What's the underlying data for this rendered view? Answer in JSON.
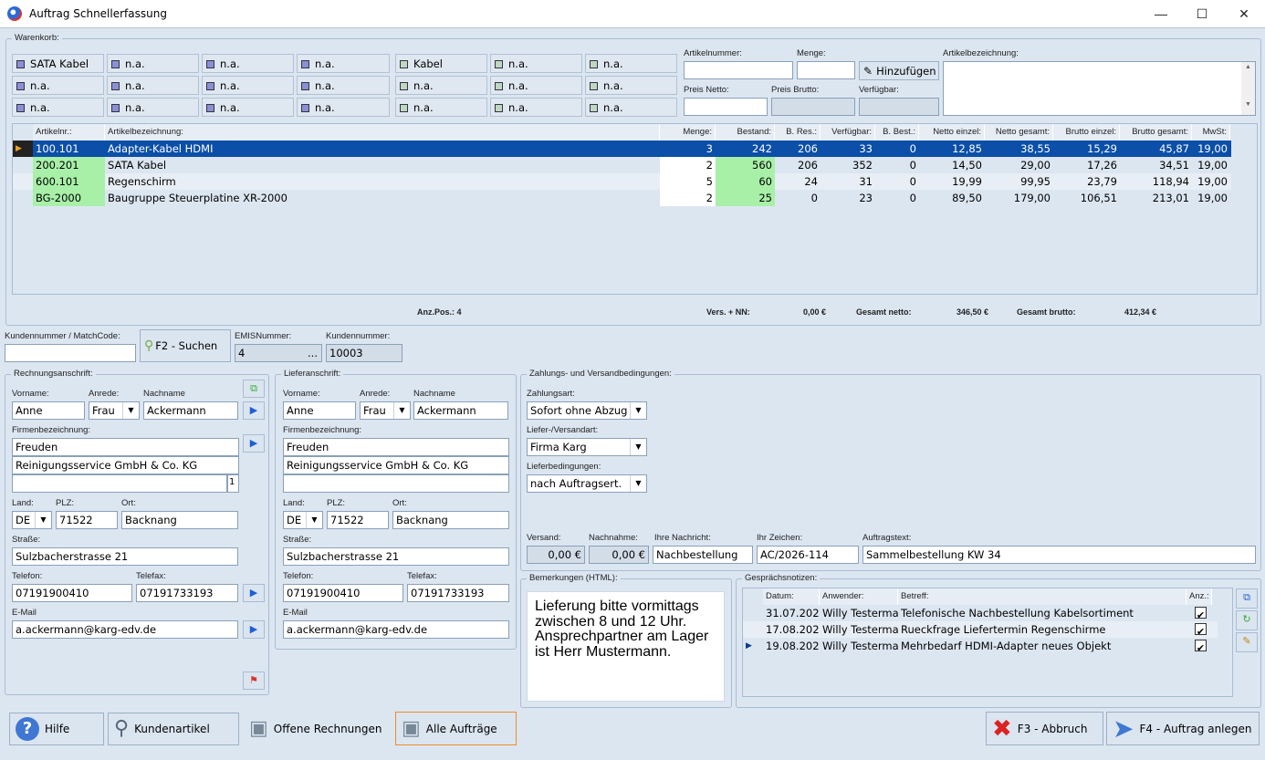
{
  "window": {
    "title": "Auftrag Schnellerfassung"
  },
  "warenkorb": {
    "label": "Warenkorb:",
    "buttons": [
      [
        "SATA Kabel",
        "n.a.",
        "n.a.",
        "n.a.",
        "Kabel",
        "n.a.",
        "n.a."
      ],
      [
        "n.a.",
        "n.a.",
        "n.a.",
        "n.a.",
        "n.a.",
        "n.a.",
        "n.a."
      ],
      [
        "n.a.",
        "n.a.",
        "n.a.",
        "n.a.",
        "n.a.",
        "n.a.",
        "n.a."
      ]
    ],
    "artikelnummer_label": "Artikelnummer:",
    "menge_label": "Menge:",
    "hinzufuegen": "Hinzufügen",
    "artikelbezeichnung_label": "Artikelbezeichnung:",
    "preis_netto_label": "Preis Netto:",
    "preis_brutto_label": "Preis Brutto:",
    "verfuegbar_label": "Verfügbar:"
  },
  "grid": {
    "headers": [
      "Artikelnr.:",
      "Artikelbezeichnung:",
      "Menge:",
      "Bestand:",
      "B. Res.:",
      "Verfügbar:",
      "B. Best.:",
      "Netto einzel:",
      "Netto gesamt:",
      "Brutto einzel:",
      "Brutto gesamt:",
      "MwSt:"
    ],
    "rows": [
      [
        "100.101",
        "Adapter-Kabel HDMI",
        "3",
        "242",
        "206",
        "33",
        "0",
        "12,85",
        "38,55",
        "15,29",
        "45,87",
        "19,00"
      ],
      [
        "200.201",
        "SATA Kabel",
        "2",
        "560",
        "206",
        "352",
        "0",
        "14,50",
        "29,00",
        "17,26",
        "34,51",
        "19,00"
      ],
      [
        "600.101",
        "Regenschirm",
        "5",
        "60",
        "24",
        "31",
        "0",
        "19,99",
        "99,95",
        "23,79",
        "118,94",
        "19,00"
      ],
      [
        "BG-2000",
        "Baugruppe Steuerplatine XR-2000",
        "2",
        "25",
        "0",
        "23",
        "0",
        "89,50",
        "179,00",
        "106,51",
        "213,01",
        "19,00"
      ]
    ],
    "footer": {
      "anz_pos": "Anz.Pos.: 4",
      "vers_label": "Vers. + NN:",
      "vers_value": "0,00 €",
      "netto_label": "Gesamt netto:",
      "netto_value": "346,50 €",
      "brutto_label": "Gesamt brutto:",
      "brutto_value": "412,34 €"
    }
  },
  "kunde": {
    "kundennummer_match_label": "Kundennummer / MatchCode:",
    "suchen": "F2 - Suchen",
    "emis_label": "EMISNummer:",
    "emis_value": "4",
    "emis_btn": "...",
    "kundennummer_label": "Kundennummer:",
    "kundennummer_value": "10003"
  },
  "rechnung": {
    "label": "Rechnungsanschrift:",
    "vorname_label": "Vorname:",
    "vorname": "Anne",
    "anrede_label": "Anrede:",
    "anrede": "Frau",
    "nachname_label": "Nachname",
    "nachname": "Ackermann",
    "firma_label": "Firmenbezeichnung:",
    "firma1": "Freuden",
    "firma2": "Reinigungsservice GmbH & Co. KG",
    "firma_count": "1",
    "land_label": "Land:",
    "land": "DE",
    "plz_label": "PLZ:",
    "plz": "71522",
    "ort_label": "Ort:",
    "ort": "Backnang",
    "strasse_label": "Straße:",
    "strasse": "Sulzbacherstrasse 21",
    "telefon_label": "Telefon:",
    "telefon": "07191900410",
    "telefax_label": "Telefax:",
    "telefax": "07191733193",
    "email_label": "E-Mail",
    "email": "a.ackermann@karg-edv.de"
  },
  "liefer": {
    "label": "Lieferanschrift:",
    "vorname_label": "Vorname:",
    "vorname": "Anne",
    "anrede_label": "Anrede:",
    "anrede": "Frau",
    "nachname_label": "Nachname",
    "nachname": "Ackermann",
    "firma_label": "Firmenbezeichnung:",
    "firma1": "Freuden",
    "firma2": "Reinigungsservice GmbH & Co. KG",
    "land_label": "Land:",
    "land": "DE",
    "plz_label": "PLZ:",
    "plz": "71522",
    "ort_label": "Ort:",
    "ort": "Backnang",
    "strasse_label": "Straße:",
    "strasse": "Sulzbacherstrasse 21",
    "telefon_label": "Telefon:",
    "telefon": "07191900410",
    "telefax_label": "Telefax:",
    "telefax": "07191733193",
    "email_label": "E-Mail",
    "email": "a.ackermann@karg-edv.de"
  },
  "zahlung": {
    "label": "Zahlungs- und Versandbedingungen:",
    "zahlungsart_label": "Zahlungsart:",
    "zahlungsart": "Sofort ohne Abzug",
    "versandart_label": "Liefer-/Versandart:",
    "versandart": "Firma Karg",
    "lieferbed_label": "Lieferbedingungen:",
    "lieferbed": "nach  Auftragsert.",
    "versand_label": "Versand:",
    "versand": "0,00 €",
    "nachnahme_label": "Nachnahme:",
    "nachnahme": "0,00 €",
    "nachricht_label": "Ihre Nachricht:",
    "nachricht": "Nachbestellung",
    "zeichen_label": "Ihr Zeichen:",
    "zeichen": "AC/2026-114",
    "auftragstext_label": "Auftragstext:",
    "auftragstext": "Sammelbestellung KW 34"
  },
  "bemerkungen": {
    "label": "Bemerkungen (HTML):",
    "text": "Lieferung bitte vormittags zwischen 8 und 12 Uhr. Ansprechpartner am Lager ist Herr Mustermann."
  },
  "notizen": {
    "label": "Gesprächsnotizen:",
    "headers": [
      "Datum:",
      "Anwender:",
      "Betreff:",
      "Anz.:"
    ],
    "rows": [
      [
        "31.07.202",
        "Willy Testerma",
        "Telefonische Nachbestellung Kabelsortiment"
      ],
      [
        "17.08.202",
        "Willy Testerma",
        "Rueckfrage Liefertermin Regenschirme"
      ],
      [
        "19.08.202",
        "Willy Testerma",
        "Mehrbedarf HDMI-Adapter neues Objekt"
      ]
    ]
  },
  "bottom": {
    "hilfe": "Hilfe",
    "kundenartikel": "Kundenartikel",
    "offene": "Offene Rechnungen",
    "alle": "Alle Aufträge",
    "abbruch": "F3 - Abbruch",
    "anlegen": "F4 - Auftrag anlegen"
  }
}
